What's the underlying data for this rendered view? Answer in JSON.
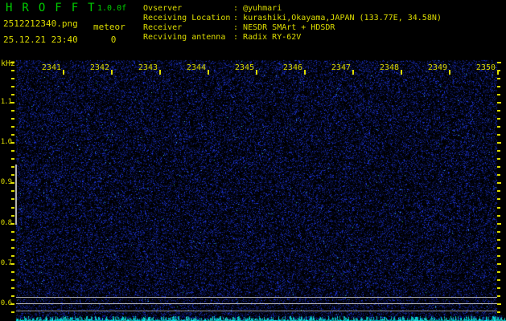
{
  "header": {
    "app_title": "HROFFT",
    "version": "1.0.0f",
    "filename": "2512212340.png",
    "mode_label": "meteor",
    "datetime": "25.12.21 23:40",
    "meteor_count": "0",
    "separator": ": ",
    "info_rows": [
      {
        "label": "Ovserver",
        "value": "@yuhmari"
      },
      {
        "label": "Receiving Location",
        "value": "kurashiki,Okayama,JAPAN (133.77E, 34.58N)"
      },
      {
        "label": "Receiver",
        "value": "NESDR SMArt + HDSDR"
      },
      {
        "label": "Recviving antenna",
        "value": "Radix RY-62V"
      }
    ]
  },
  "chart_data": {
    "type": "heatmap",
    "title": "HROFFT 10-minute radio meteor spectrogram (frequency vs time)",
    "ylabel": "kHz",
    "x_tick_labels": [
      "2341",
      "2342",
      "2343",
      "2344",
      "2345",
      "2346",
      "2347",
      "2348",
      "2349",
      "2350"
    ],
    "x_minutes_per_division": 1,
    "y_tick_labels": [
      "1.1",
      "1.0",
      "0.9",
      "0.8",
      "0.7",
      "0.6"
    ],
    "y_major_ticks_khz": [
      1.1,
      1.0,
      0.9,
      0.8,
      0.7,
      0.6
    ],
    "y_minor_step_khz": 0.02,
    "y_range_khz": [
      0.58,
      1.2
    ],
    "carrier_lines_khz": [
      0.62,
      0.6,
      0.58
    ],
    "detection_window_khz": [
      0.8,
      0.95
    ],
    "meteor_echo_count": 0,
    "content_note": "uniform dark-blue background noise, no meteor echoes visible",
    "bottom_strip_note": "cyan broadband signal-level noise band along bottom edge"
  },
  "colors": {
    "background": "#000000",
    "title_green": "#00cd00",
    "text_yellow": "#dcdc00",
    "noise_blue": "#2020a0",
    "bright_speck": "#5078ff",
    "band_cyan": "#00e0e0",
    "carrier_gray": "#c6c6c6"
  }
}
